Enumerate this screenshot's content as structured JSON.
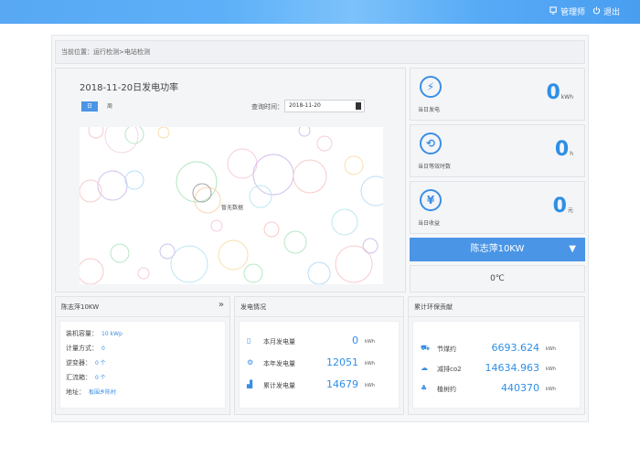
{
  "topbar": {
    "user_label": "管理师",
    "logout_label": "退出"
  },
  "breadcrumb": "当前位置：运行检测>电站检测",
  "chart": {
    "title": "2018-11-20日发电功率",
    "tab_day": "日",
    "tab_week": "周",
    "query_label": "查询时间：",
    "query_value": "2018-11-20",
    "plot_label": "暂无数据"
  },
  "stats": [
    {
      "label": "当日发电",
      "value": "0",
      "unit": "kWh",
      "icon": "lightning-icon",
      "glyph": "⚡"
    },
    {
      "label": "当日等效时数",
      "value": "0",
      "unit": "h",
      "icon": "clock-history-icon",
      "glyph": "⟲"
    },
    {
      "label": "当日收益",
      "value": "0",
      "unit": "元",
      "icon": "yen-icon",
      "glyph": "¥"
    }
  ],
  "station": {
    "name": "陈志萍10KW",
    "arrow": "▼"
  },
  "temperature": "0℃",
  "info_panel": {
    "title": "陈志萍10KW",
    "expand_glyph": "»",
    "rows": [
      {
        "label": "装机容量：",
        "value": "10 kWp"
      },
      {
        "label": "计量方式：",
        "value": "0"
      },
      {
        "label": "逆变器：",
        "value": "0 个"
      },
      {
        "label": "汇流箱：",
        "value": "0 个"
      },
      {
        "label": "地址：",
        "value": "板围乡陈村"
      }
    ]
  },
  "generation_panel": {
    "title": "发电情况",
    "rows": [
      {
        "label": "本月发电量",
        "value": "0",
        "unit": "kWh",
        "icon": "calendar-icon",
        "glyph": "▯"
      },
      {
        "label": "本年发电量",
        "value": "12051",
        "unit": "kWh",
        "icon": "gear-icon",
        "glyph": "⚙"
      },
      {
        "label": "累计发电量",
        "value": "14679",
        "unit": "kWh",
        "icon": "bar-chart-icon",
        "glyph": "▟"
      }
    ]
  },
  "env_panel": {
    "title": "累计环保贡献",
    "rows": [
      {
        "label": "节煤约",
        "value": "6693.624",
        "unit": "kWh",
        "icon": "car-icon",
        "glyph": "⛟"
      },
      {
        "label": "减排co2",
        "value": "14634.963",
        "unit": "kWh",
        "icon": "co2-icon",
        "glyph": "☁"
      },
      {
        "label": "植树约",
        "value": "440370",
        "unit": "kWh",
        "icon": "tree-icon",
        "glyph": "♣"
      }
    ]
  },
  "colors": {
    "accent": "#4a95e6",
    "value": "#2e8fe6",
    "topbar": "#58a8f4"
  }
}
